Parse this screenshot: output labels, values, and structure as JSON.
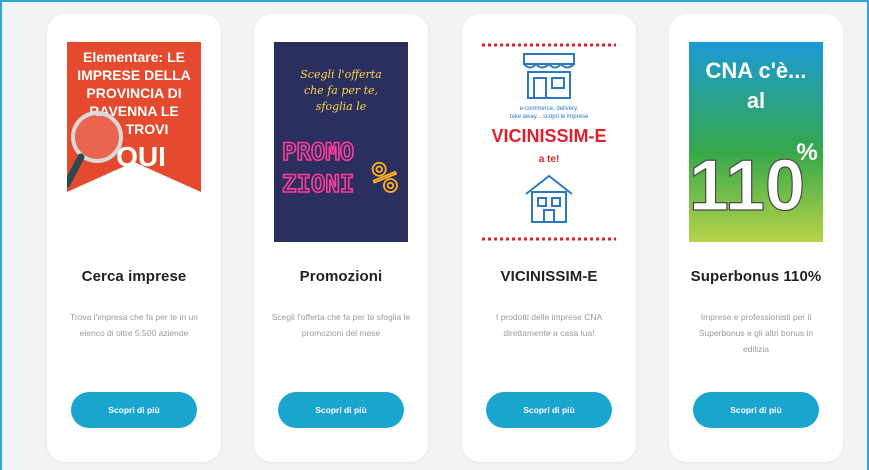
{
  "cards": [
    {
      "title": "Cerca imprese",
      "description": "Trova l'impresa che fa per te in un elenco di oltre 5.500 aziende",
      "button": "Scopri di più",
      "image_text": [
        "Elementare: LE",
        "IMPRESE DELLA",
        "PROVINCIA DI",
        "RAVENNA LE",
        "TROVI",
        "QUI"
      ]
    },
    {
      "title": "Promozioni",
      "description": "Scegli l'offerta che fa per te sfoglia le promozioni del mese",
      "button": "Scopri di più",
      "image_text": [
        "Scegli l'offerta",
        "che fa per te,",
        "sfoglia le",
        "PROMO",
        "ZIONI",
        "%"
      ]
    },
    {
      "title": "VICINISSIM-E",
      "description": "I prodotti delle imprese CNA direttamente a casa tua!",
      "button": "Scopri di più",
      "image_text": [
        "e-commerce, delivery,",
        "take away... scopri le imprese",
        "VICINISSIM-E",
        "a te!"
      ]
    },
    {
      "title": "Superbonus 110%",
      "description": "Imprese e professionisti per il Superbonus e gli altri bonus in edilizia",
      "button": "Scopri di più",
      "image_text": [
        "CNA c'è...",
        "al",
        "110",
        "%"
      ]
    }
  ],
  "colors": {
    "accent": "#1aa6cc",
    "frame_border": "#2ea5d8",
    "cna_red": "#e64a2e",
    "promo_bg": "#2b2f5e",
    "promo_pink": "#ff3d9e",
    "vic_blue": "#2a78c4",
    "vic_red": "#e0202c",
    "sb_green": "#35a84a"
  }
}
